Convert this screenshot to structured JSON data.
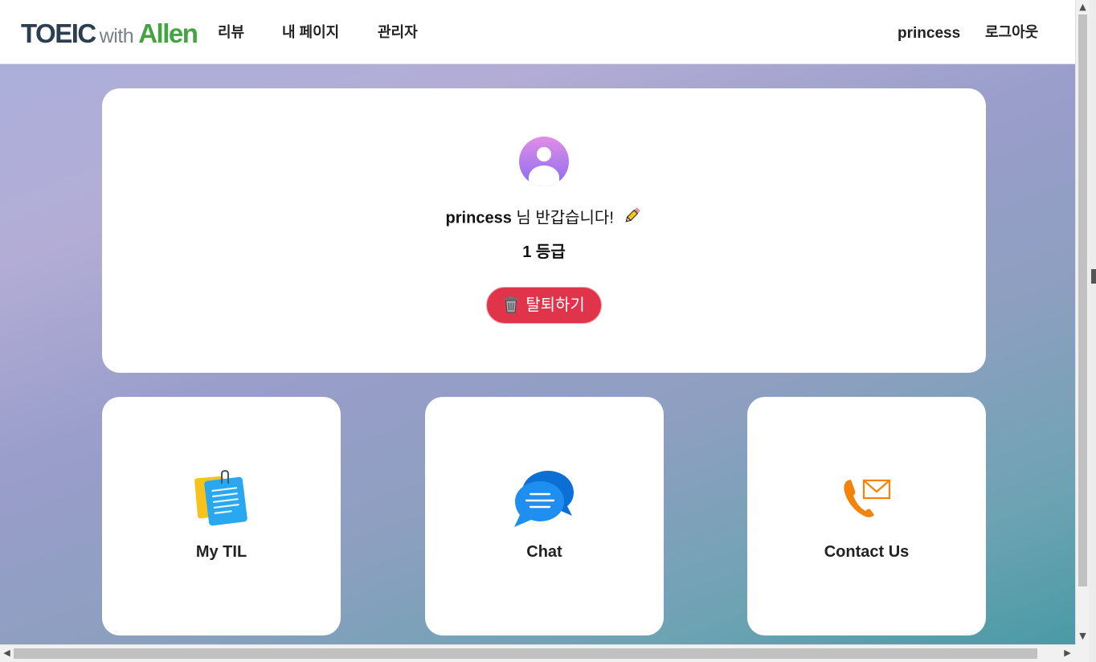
{
  "navbar": {
    "logo": {
      "part1": "TOEIC",
      "part2": "with",
      "part3": "Allen"
    },
    "links": [
      "리뷰",
      "내 페이지",
      "관리자"
    ],
    "username": "princess",
    "logout_label": "로그아웃"
  },
  "profile": {
    "username": "princess",
    "greeting_suffix": "님 반갑습니다!",
    "grade": "1 등급",
    "withdraw_label": "탈퇴하기"
  },
  "cards": [
    {
      "label": "My TIL",
      "icon": "notepad-icon"
    },
    {
      "label": "Chat",
      "icon": "chat-bubble-icon"
    },
    {
      "label": "Contact Us",
      "icon": "phone-mail-icon"
    }
  ],
  "colors": {
    "logo_dark": "#2c3e50",
    "logo_green": "#43a542",
    "withdraw_red": "#e0344b",
    "avatar_gradient_top": "#e08ee6",
    "avatar_gradient_bottom": "#8a6cf0"
  }
}
